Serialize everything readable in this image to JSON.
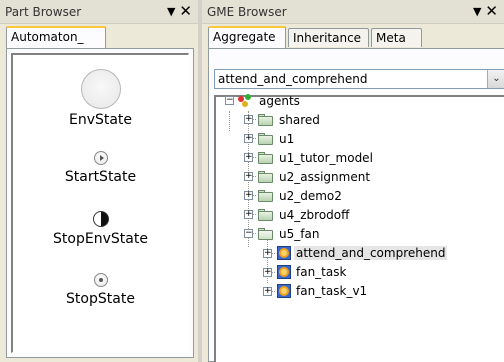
{
  "part_browser": {
    "title": "Part Browser",
    "pin_glyph": "▼",
    "close_glyph": "✕",
    "tab_label": "Automaton_",
    "parts": [
      {
        "label": "EnvState",
        "icon": "state-circle-icon"
      },
      {
        "label": "StartState",
        "icon": "start-state-icon"
      },
      {
        "label": "StopEnvState",
        "icon": "stop-env-state-icon"
      },
      {
        "label": "StopState",
        "icon": "stop-state-icon"
      }
    ]
  },
  "gme_browser": {
    "title": "GME Browser",
    "pin_glyph": "▼",
    "close_glyph": "✕",
    "tabs": [
      {
        "label": "Aggregate",
        "active": true
      },
      {
        "label": "Inheritance",
        "active": false
      },
      {
        "label": "Meta",
        "active": false
      }
    ],
    "combo_value": "attend_and_comprehend",
    "combo_arrow": "⌄",
    "tree": {
      "root": {
        "label": "agents",
        "expander": "−",
        "icon": "agents-folder-icon"
      },
      "children": [
        {
          "label": "shared",
          "expander": "+",
          "icon": "folder-icon"
        },
        {
          "label": "u1",
          "expander": "+",
          "icon": "folder-icon"
        },
        {
          "label": "u1_tutor_model",
          "expander": "+",
          "icon": "folder-icon"
        },
        {
          "label": "u2_assignment",
          "expander": "+",
          "icon": "folder-icon"
        },
        {
          "label": "u2_demo2",
          "expander": "+",
          "icon": "folder-icon"
        },
        {
          "label": "u4_zbrodoff",
          "expander": "+",
          "icon": "folder-icon"
        },
        {
          "label": "u5_fan",
          "expander": "−",
          "icon": "open-folder-icon"
        }
      ],
      "u5_children": [
        {
          "label": "attend_and_comprehend",
          "expander": "+",
          "icon": "model-icon",
          "selected": true
        },
        {
          "label": "fan_task",
          "expander": "+",
          "icon": "model-icon",
          "selected": false
        },
        {
          "label": "fan_task_v1",
          "expander": "+",
          "icon": "model-icon",
          "selected": false
        }
      ]
    }
  }
}
